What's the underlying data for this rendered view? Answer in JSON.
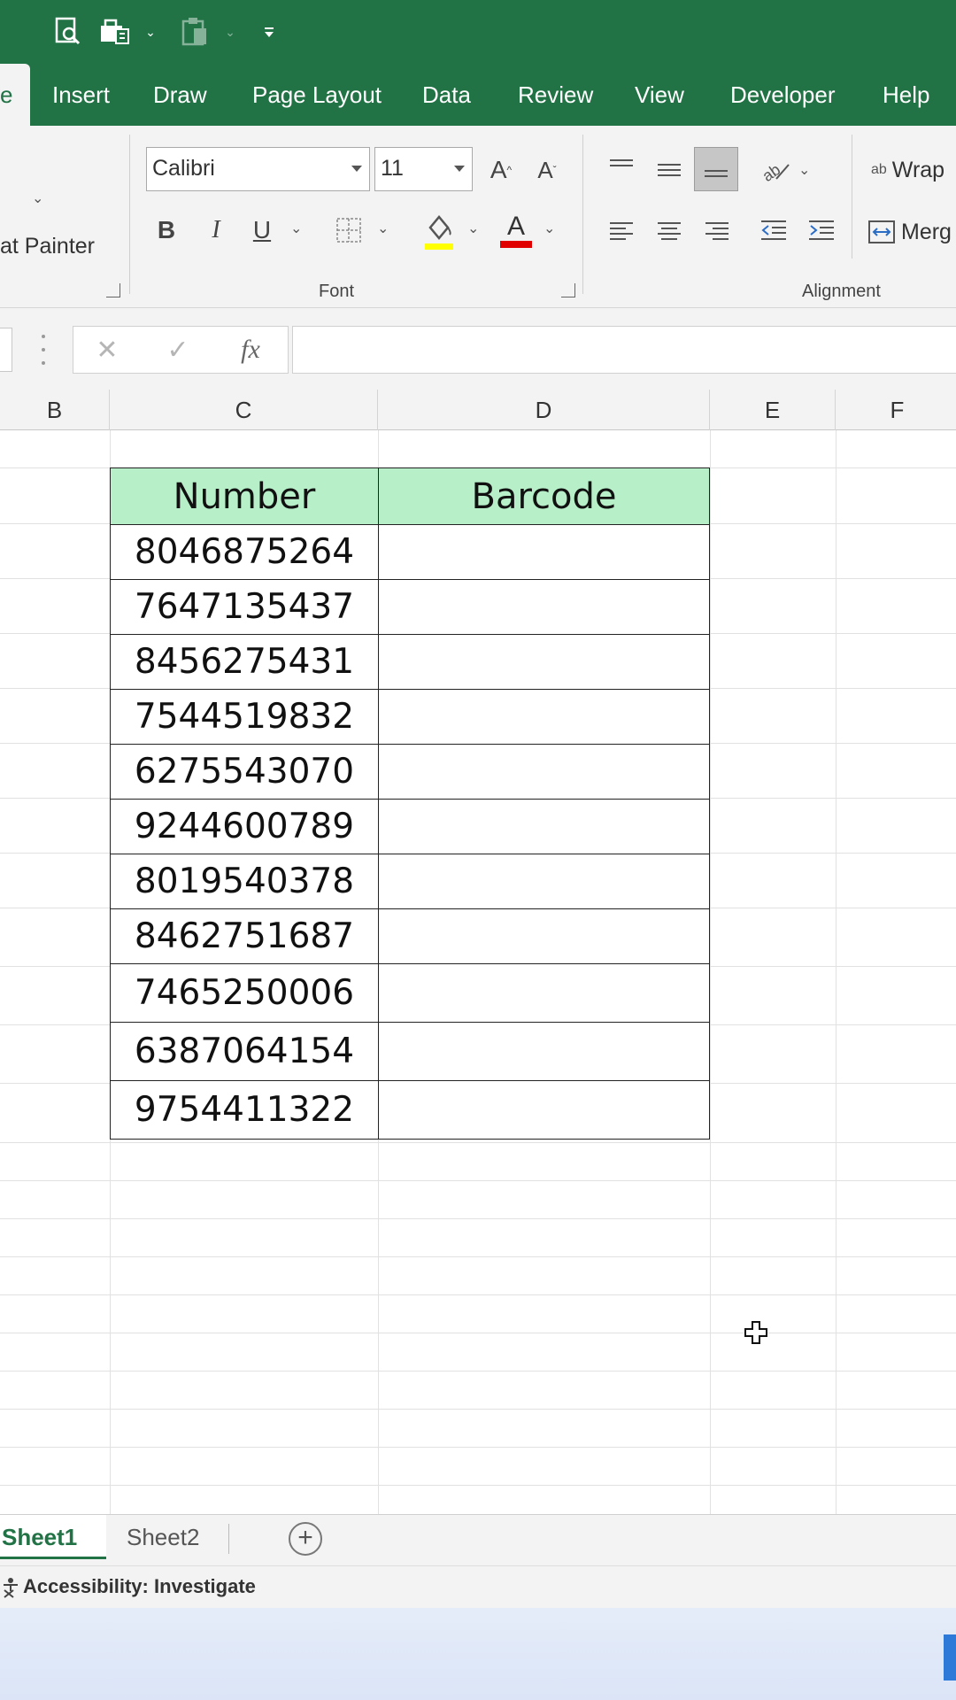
{
  "ribbon": {
    "tabs": [
      {
        "label": "e",
        "active": true
      },
      {
        "label": "Insert"
      },
      {
        "label": "Draw"
      },
      {
        "label": "Page Layout"
      },
      {
        "label": "Data"
      },
      {
        "label": "Review"
      },
      {
        "label": "View"
      },
      {
        "label": "Developer"
      },
      {
        "label": "Help"
      }
    ],
    "clipboard": {
      "format_painter_label": "at Painter"
    },
    "font": {
      "font_name": "Calibri",
      "font_size": "11",
      "group_label": "Font",
      "bold": "B",
      "italic": "I",
      "underline": "U",
      "font_color_glyph": "A",
      "grow_font_glyph": "A",
      "shrink_font_glyph": "A",
      "highlight_color": "#ffff00",
      "font_color": "#e00000"
    },
    "alignment": {
      "group_label": "Alignment",
      "wrap_text_label": "Wrap",
      "merge_label": "Merg",
      "wrap_icon_text": "ab"
    }
  },
  "formula_bar": {
    "fx_label": "fx",
    "value": ""
  },
  "columns": [
    "B",
    "C",
    "D",
    "E",
    "F"
  ],
  "table": {
    "headers": [
      "Number",
      "Barcode"
    ],
    "rows": [
      {
        "number": "8046875264",
        "barcode": ""
      },
      {
        "number": "7647135437",
        "barcode": ""
      },
      {
        "number": "8456275431",
        "barcode": ""
      },
      {
        "number": "7544519832",
        "barcode": ""
      },
      {
        "number": "6275543070",
        "barcode": ""
      },
      {
        "number": "9244600789",
        "barcode": ""
      },
      {
        "number": "8019540378",
        "barcode": ""
      },
      {
        "number": "8462751687",
        "barcode": ""
      },
      {
        "number": "7465250006",
        "barcode": ""
      },
      {
        "number": "6387064154",
        "barcode": ""
      },
      {
        "number": "9754411322",
        "barcode": ""
      }
    ],
    "header_fill": "#b6efc8"
  },
  "sheets": {
    "tabs": [
      "Sheet1",
      "Sheet2"
    ],
    "active": "Sheet1",
    "add_label": "+"
  },
  "status": {
    "accessibility": "Accessibility: Investigate"
  },
  "colors": {
    "excel_green": "#217346",
    "ribbon_bg": "#f3f3f3"
  }
}
